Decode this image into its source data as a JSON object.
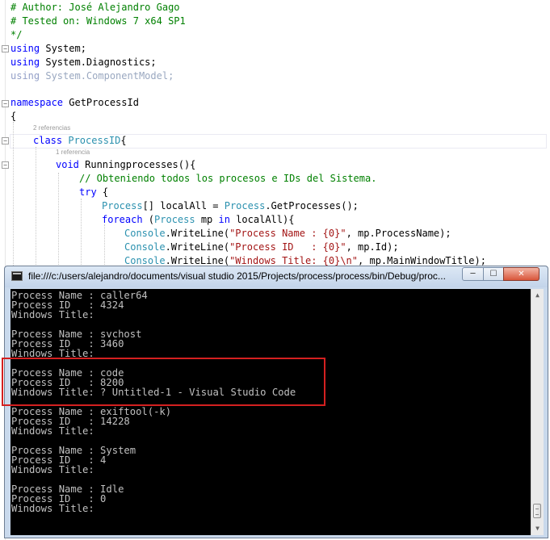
{
  "editor": {
    "meta_refs_class": "2 referencias",
    "meta_refs_method": "1 referencia",
    "lines": {
      "l1": "# Author: José Alejandro Gago",
      "l2": "# Tested on: Windows 7 x64 SP1",
      "l3": "*/",
      "using_kw": "using",
      "using1_ns": " System;",
      "using2_ns": " System.Diagnostics;",
      "using3_ns": " System.ComponentModel;",
      "namespace_kw": "namespace",
      "namespace_name": " GetProcessId",
      "brace_open": "{",
      "class_kw": "class",
      "class_name": "ProcessID",
      "class_brace": "{",
      "void_kw": "void",
      "method_sig": " Runningprocesses(){",
      "comment_line": "// Obteniendo todos los procesos e IDs del Sistema.",
      "try_kw": "try",
      "try_brace": " {",
      "process_type": "Process",
      "arr_decl": "[] localAll = ",
      "process_type2": "Process",
      "get_call": ".GetProcesses();",
      "foreach_kw": "foreach",
      "foreach_open": " (",
      "process_type3": "Process",
      "foreach_mp": " mp ",
      "in_kw": "in",
      "foreach_rest": " localAll){",
      "console_type": "Console",
      "writeline": ".WriteLine(",
      "str_name": "\"Process Name : {0}\"",
      "arg_name": ", mp.ProcessName);",
      "str_id": "\"Process ID   : {0}\"",
      "arg_id": ", mp.Id);",
      "str_title": "\"Windows Title: {0}\\n\"",
      "arg_title": ", mp.MainWindowTitle);"
    }
  },
  "console": {
    "title": "file:///c:/users/alejandro/documents/visual studio 2015/Projects/process/process/bin/Debug/proc...",
    "buttons": {
      "minimize": "─",
      "maximize": "☐",
      "close": "✕"
    },
    "scroll_up": "▲",
    "scroll_down": "▼",
    "lines": [
      "Process Name : caller64",
      "Process ID   : 4324",
      "Windows Title:",
      "",
      "Process Name : svchost",
      "Process ID   : 3460",
      "Windows Title:",
      "",
      "Process Name : code",
      "Process ID   : 8200",
      "Windows Title: ? Untitled-1 - Visual Studio Code",
      "",
      "Process Name : exiftool(-k)",
      "Process ID   : 14228",
      "Windows Title:",
      "",
      "Process Name : System",
      "Process ID   : 4",
      "Windows Title:",
      "",
      "Process Name : Idle",
      "Process ID   : 0",
      "Windows Title:"
    ]
  },
  "colors": {
    "comment": "#008000",
    "keyword": "#0000ff",
    "type": "#2b91af",
    "string": "#a31515",
    "highlight": "#d42020",
    "console_bg": "#000000",
    "console_text": "#c0c0c0"
  }
}
